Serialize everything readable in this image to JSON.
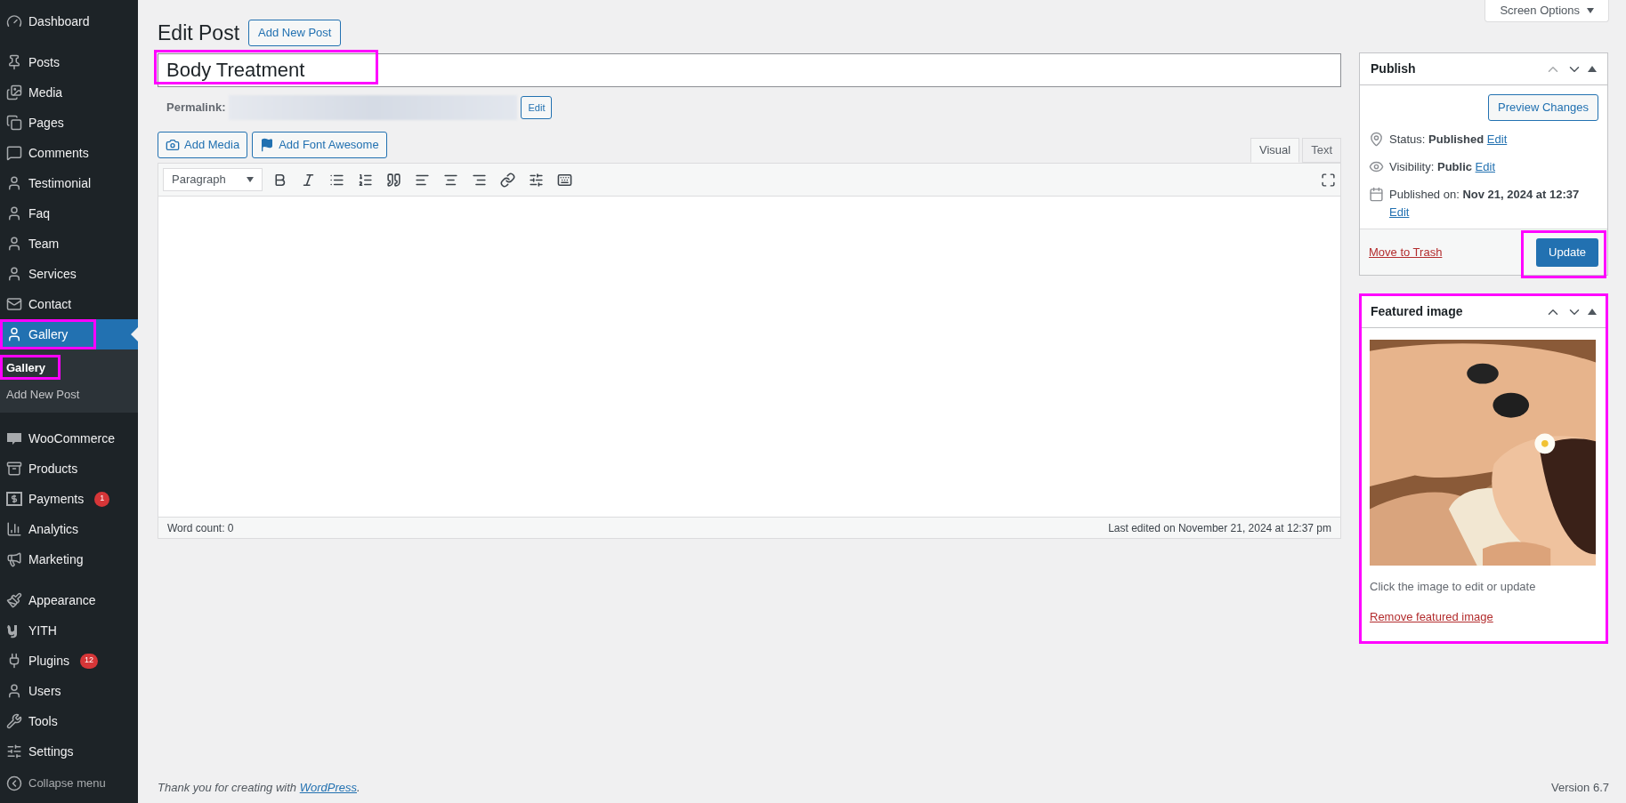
{
  "sidebar": {
    "groups": [
      [
        {
          "label": "Dashboard",
          "selected": false,
          "highlighted": false
        }
      ],
      [
        {
          "label": "Posts",
          "selected": false,
          "highlighted": false
        },
        {
          "label": "Media",
          "selected": false,
          "highlighted": false
        },
        {
          "label": "Pages",
          "selected": false,
          "highlighted": false
        },
        {
          "label": "Comments",
          "selected": false,
          "highlighted": false
        },
        {
          "label": "Testimonial",
          "selected": false,
          "highlighted": false
        },
        {
          "label": "Faq",
          "selected": false,
          "highlighted": false
        },
        {
          "label": "Team",
          "selected": false,
          "highlighted": false
        },
        {
          "label": "Services",
          "selected": false,
          "highlighted": false
        },
        {
          "label": "Contact",
          "selected": false,
          "highlighted": false
        },
        {
          "label": "Gallery",
          "selected": true,
          "highlighted": true,
          "children": [
            {
              "label": "Gallery",
              "selected": true,
              "highlighted": true
            },
            {
              "label": "Add New Post",
              "selected": false,
              "highlighted": false
            }
          ]
        }
      ],
      [
        {
          "label": "WooCommerce",
          "selected": false,
          "highlighted": false
        },
        {
          "label": "Products",
          "selected": false,
          "highlighted": false
        },
        {
          "label": "Payments",
          "badge": "1",
          "selected": false,
          "highlighted": false
        },
        {
          "label": "Analytics",
          "selected": false,
          "highlighted": false
        },
        {
          "label": "Marketing",
          "selected": false,
          "highlighted": false
        }
      ],
      [
        {
          "label": "Appearance",
          "selected": false,
          "highlighted": false
        },
        {
          "label": "YITH",
          "selected": false,
          "highlighted": false
        },
        {
          "label": "Plugins",
          "badge": "12",
          "selected": false,
          "highlighted": false
        },
        {
          "label": "Users",
          "selected": false,
          "highlighted": false
        },
        {
          "label": "Tools",
          "selected": false,
          "highlighted": false
        },
        {
          "label": "Settings",
          "selected": false,
          "highlighted": false
        }
      ]
    ],
    "collapse": "Collapse menu"
  },
  "screen_options": "Screen Options",
  "header": {
    "title": "Edit Post",
    "button": "Add New Post"
  },
  "post_title": {
    "value": "Body Treatment",
    "highlighted": true
  },
  "permalink": {
    "label": "Permalink:",
    "button": "Edit"
  },
  "media_buttons": [
    "Add Media",
    "Add Font Awesome"
  ],
  "editor": {
    "tabs": [
      {
        "label": "Visual",
        "selected": true
      },
      {
        "label": "Text",
        "selected": false
      }
    ],
    "format": "Paragraph",
    "word_count": "Word count: 0",
    "last_edited": "Last edited on November 21, 2024 at 12:37 pm"
  },
  "publish": {
    "title": "Publish",
    "preview": "Preview Changes",
    "rows": [
      {
        "label": "Status:",
        "value": "Published",
        "link": "Edit"
      },
      {
        "label": "Visibility:",
        "value": "Public",
        "link": "Edit"
      },
      {
        "label": "Published on:",
        "value": "Nov 21, 2024 at 12:37",
        "link": "Edit"
      }
    ],
    "trash": "Move to Trash",
    "update": "Update",
    "update_highlighted": true
  },
  "featured": {
    "title": "Featured image",
    "hint": "Click the image to edit or update",
    "remove": "Remove featured image",
    "highlighted": true
  },
  "footer": {
    "text_before": "Thank you for creating with",
    "link": "WordPress",
    "text_after": ".",
    "version": "Version 6.7"
  }
}
